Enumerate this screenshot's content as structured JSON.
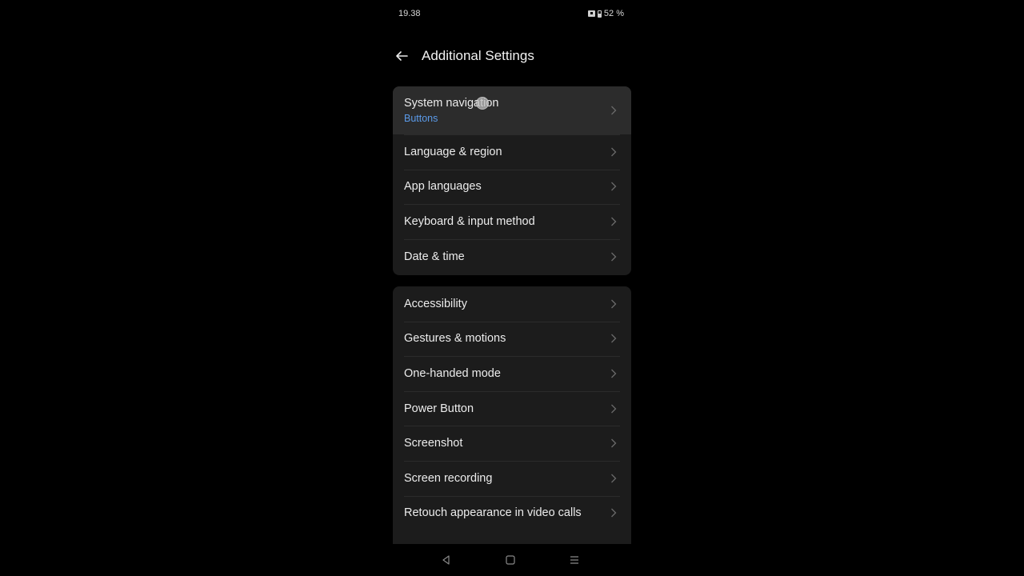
{
  "status_bar": {
    "time": "19.38",
    "battery": "52 %"
  },
  "header": {
    "title": "Additional Settings"
  },
  "groups": [
    {
      "items": [
        {
          "label": "System navigation",
          "subtitle": "Buttons"
        },
        {
          "label": "Language & region"
        },
        {
          "label": "App languages"
        },
        {
          "label": "Keyboard & input method"
        },
        {
          "label": "Date & time"
        }
      ]
    },
    {
      "items": [
        {
          "label": "Accessibility"
        },
        {
          "label": "Gestures & motions"
        },
        {
          "label": "One-handed mode"
        },
        {
          "label": "Power Button"
        },
        {
          "label": "Screenshot"
        },
        {
          "label": "Screen recording"
        },
        {
          "label": "Retouch appearance in video calls"
        }
      ]
    }
  ],
  "colors": {
    "background": "#000000",
    "card": "#1c1c1c",
    "highlight_row": "#2c2c2c",
    "accent_subtitle": "#5b9ae8",
    "text": "#ececec"
  },
  "icons": {
    "back": "arrow-left-icon",
    "chevron": "chevron-right-icon",
    "nav_back": "triangle-back-icon",
    "nav_home": "square-home-icon",
    "nav_recent": "menu-lines-icon"
  }
}
